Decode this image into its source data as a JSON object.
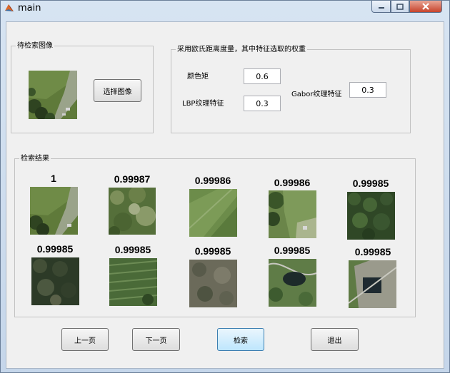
{
  "window": {
    "title": "main"
  },
  "query_group": {
    "title": "待检索图像",
    "select_button": "选择图像"
  },
  "weights_group": {
    "title": "采用欧氏距离度量，其中特征选取的权重",
    "color_label": "颜色矩",
    "color_value": "0.6",
    "lbp_label": "LBP纹理特征",
    "lbp_value": "0.3",
    "gabor_label": "Gabor纹理特征",
    "gabor_value": "0.3"
  },
  "results_group": {
    "title": "检索结果",
    "scores": [
      "1",
      "0.99987",
      "0.99986",
      "0.99986",
      "0.99985",
      "0.99985",
      "0.99985",
      "0.99985",
      "0.99985",
      "0.99985"
    ]
  },
  "buttons": {
    "prev": "上一页",
    "next": "下一页",
    "search": "检索",
    "exit": "退出"
  }
}
